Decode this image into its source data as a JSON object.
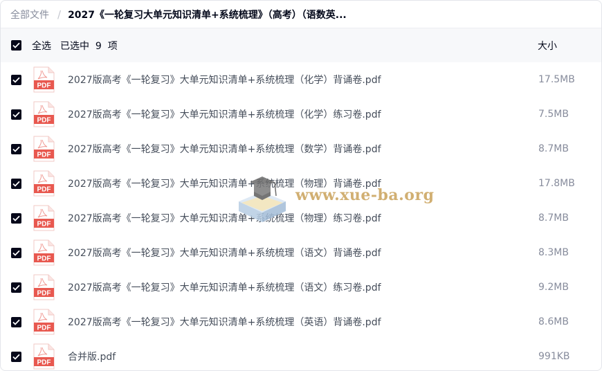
{
  "breadcrumb": {
    "root": "全部文件",
    "separator": "/",
    "current": "2027《一轮复习大单元知识清单+系统梳理》（高考）（语数英..."
  },
  "header": {
    "select_all_label": "全选",
    "selected_count": "已选中  9  项",
    "size_column": "大小"
  },
  "files": [
    {
      "name": "2027版高考《一轮复习》大单元知识清单+系统梳理（化学）背诵卷.pdf",
      "size": "17.5MB",
      "checked": true,
      "icon": "pdf-icon"
    },
    {
      "name": "2027版高考《一轮复习》大单元知识清单+系统梳理（化学）练习卷.pdf",
      "size": "7.5MB",
      "checked": true,
      "icon": "pdf-icon"
    },
    {
      "name": "2027版高考《一轮复习》大单元知识清单+系统梳理（数学）背诵卷.pdf",
      "size": "8.7MB",
      "checked": true,
      "icon": "pdf-icon"
    },
    {
      "name": "2027版高考《一轮复习》大单元知识清单+系统梳理（物理）背诵卷.pdf",
      "size": "17.8MB",
      "checked": true,
      "icon": "pdf-icon"
    },
    {
      "name": "2027版高考《一轮复习》大单元知识清单+系统梳理（物理）练习卷.pdf",
      "size": "8.7MB",
      "checked": true,
      "icon": "pdf-icon"
    },
    {
      "name": "2027版高考《一轮复习》大单元知识清单+系统梳理（语文）背诵卷.pdf",
      "size": "8.3MB",
      "checked": true,
      "icon": "pdf-icon"
    },
    {
      "name": "2027版高考《一轮复习》大单元知识清单+系统梳理（语文）练习卷.pdf",
      "size": "9.2MB",
      "checked": true,
      "icon": "pdf-icon"
    },
    {
      "name": "2027版高考《一轮复习》大单元知识清单+系统梳理（英语）背诵卷.pdf",
      "size": "8.6MB",
      "checked": true,
      "icon": "pdf-icon"
    },
    {
      "name": "合并版.pdf",
      "size": "991KB",
      "checked": true,
      "icon": "pdf-icon"
    }
  ],
  "watermark": {
    "text": "www.xue-ba.org"
  },
  "colors": {
    "checkbox": "#06081a",
    "pdf_red": "#e8584f",
    "name_text": "#454d5a",
    "size_text": "#878c9c",
    "header_bg": "#f7f8fa"
  },
  "pdf_label": "PDF"
}
